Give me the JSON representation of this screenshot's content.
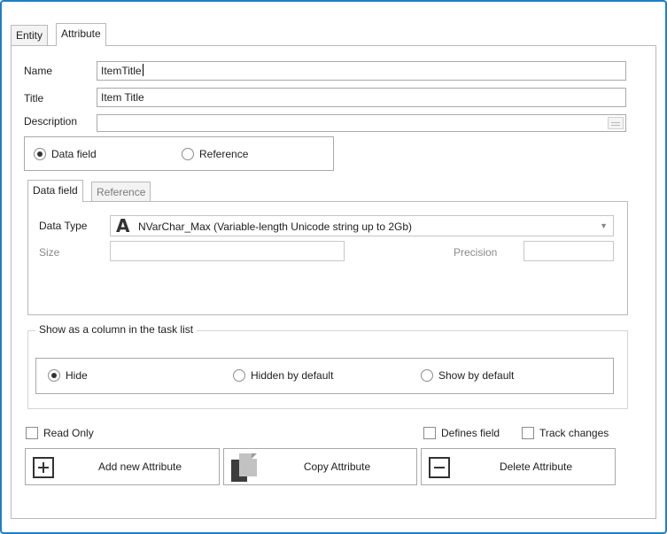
{
  "tabs": {
    "entity": "Entity",
    "attribute": "Attribute"
  },
  "fields": {
    "name_label": "Name",
    "name_value": "ItemTitle",
    "title_label": "Title",
    "title_value": "Item Title",
    "description_label": "Description",
    "description_value": ""
  },
  "kind": {
    "data_field": "Data field",
    "reference": "Reference",
    "selected": "data_field"
  },
  "inner_tabs": {
    "data_field": "Data field",
    "reference": "Reference"
  },
  "data_type": {
    "label": "Data Type",
    "icon": "letter-a-icon",
    "value": "NVarChar_Max (Variable-length Unicode string up to 2Gb)",
    "size_label": "Size",
    "size_value": "",
    "precision_label": "Precision",
    "precision_value": ""
  },
  "task_list": {
    "legend": "Show as a column in the task list",
    "hide": "Hide",
    "hidden_by_default": "Hidden by default",
    "show_by_default": "Show by default",
    "selected": "hide"
  },
  "options": {
    "read_only": "Read Only",
    "defines_field": "Defines field",
    "track_changes": "Track changes"
  },
  "buttons": {
    "add": "Add new Attribute",
    "copy": "Copy Attribute",
    "delete": "Delete Attribute"
  },
  "colors": {
    "accent": "#1e7fc6",
    "icon_dark": "#333333"
  }
}
